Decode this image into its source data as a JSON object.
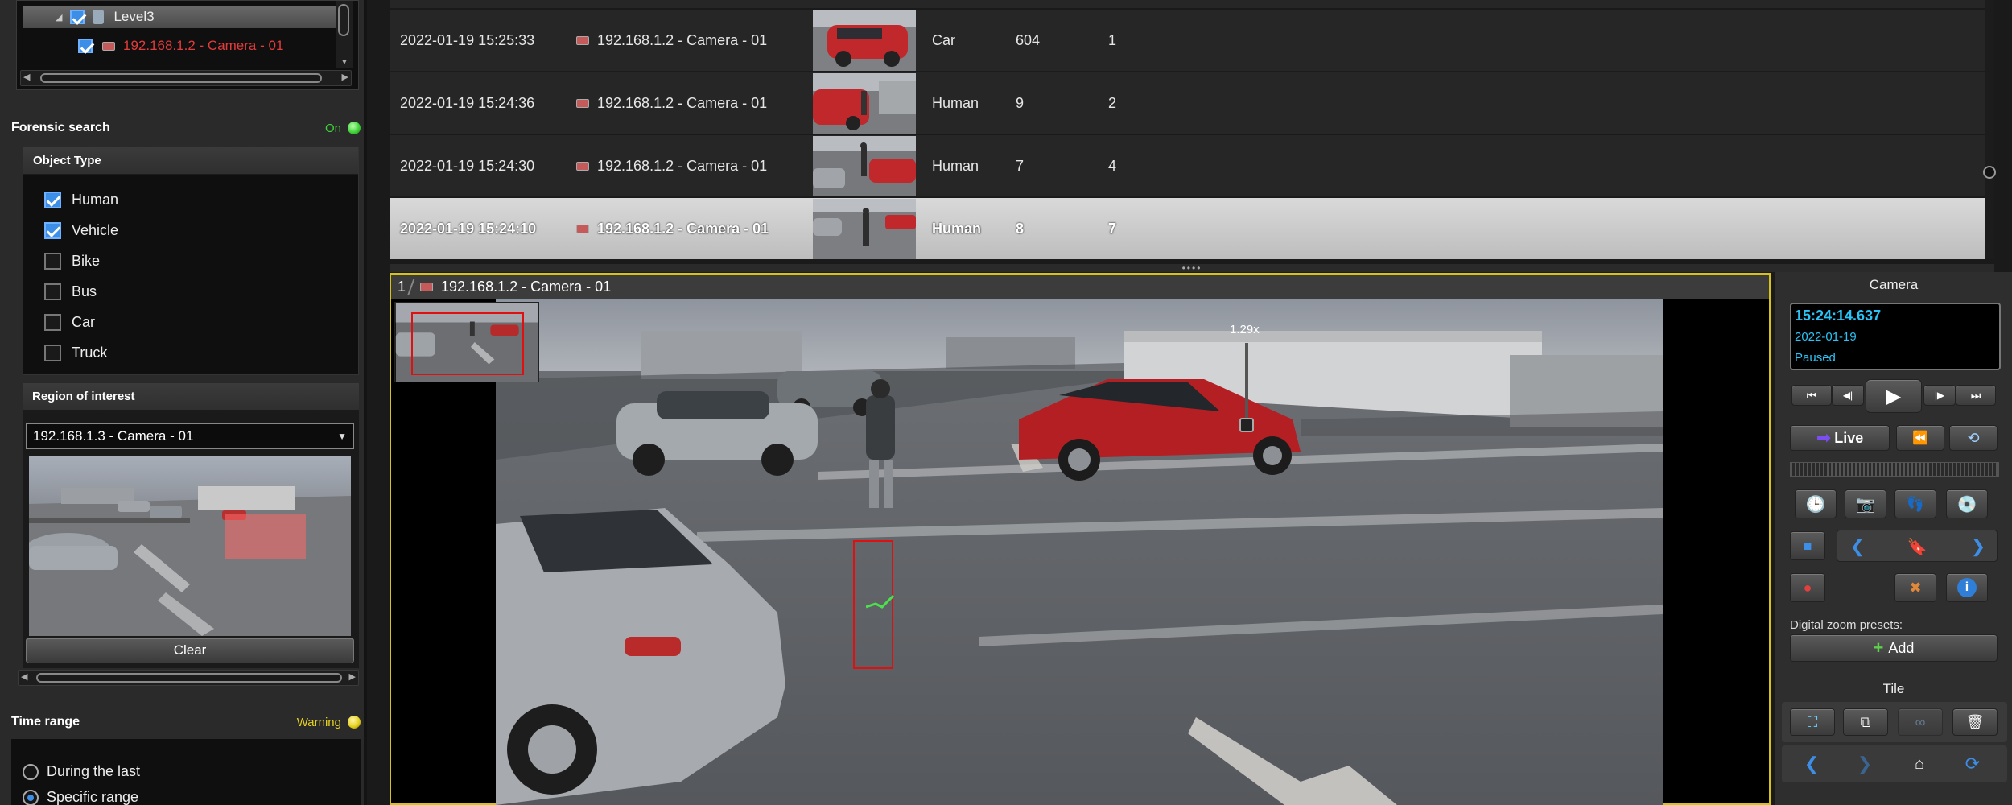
{
  "tree": {
    "level_label": "Level3",
    "camera_label": "192.168.1.2 - Camera - 01"
  },
  "forensic": {
    "title": "Forensic search",
    "status": "On",
    "status_color": "#3fd33a"
  },
  "object_type": {
    "title": "Object Type",
    "items": [
      {
        "label": "Human",
        "checked": true
      },
      {
        "label": "Vehicle",
        "checked": true
      },
      {
        "label": "Bike",
        "checked": false
      },
      {
        "label": "Bus",
        "checked": false
      },
      {
        "label": "Car",
        "checked": false
      },
      {
        "label": "Truck",
        "checked": false
      }
    ]
  },
  "region": {
    "title": "Region of interest",
    "selected_camera": "192.168.1.3 - Camera - 01",
    "clear_label": "Clear"
  },
  "time_range": {
    "title": "Time range",
    "status": "Warning",
    "status_color": "#e6d21e",
    "options": [
      {
        "label": "During the last",
        "selected": false
      },
      {
        "label": "Specific range",
        "selected": true
      }
    ]
  },
  "results": {
    "rows": [
      {
        "datetime": "2022-01-19 15:25:33",
        "camera": "192.168.1.2 - Camera - 01",
        "type": "Car",
        "id": "604",
        "count": "1",
        "selected": false
      },
      {
        "datetime": "2022-01-19 15:24:36",
        "camera": "192.168.1.2 - Camera - 01",
        "type": "Human",
        "id": "9",
        "count": "2",
        "selected": false
      },
      {
        "datetime": "2022-01-19 15:24:30",
        "camera": "192.168.1.2 - Camera - 01",
        "type": "Human",
        "id": "7",
        "count": "4",
        "selected": false
      },
      {
        "datetime": "2022-01-19 15:24:10",
        "camera": "192.168.1.2 - Camera - 01",
        "type": "Human",
        "id": "8",
        "count": "7",
        "selected": true
      }
    ]
  },
  "video": {
    "tile_index": "1",
    "camera": "192.168.1.2 - Camera - 01",
    "zoom": "1.29x"
  },
  "camera_panel": {
    "title": "Camera",
    "time": "15:24:14.637",
    "date": "2022-01-19",
    "state": "Paused",
    "live_label": "Live",
    "zoom_presets_label": "Digital zoom presets:",
    "add_label": "Add",
    "tile_title": "Tile"
  },
  "colors": {
    "accent_blue": "#3d8ee6",
    "time_cyan": "#2bc3f5",
    "tree_camera_red": "#e23b3b",
    "selection_border": "#d6c21a",
    "bbox_red": "#e01010"
  }
}
